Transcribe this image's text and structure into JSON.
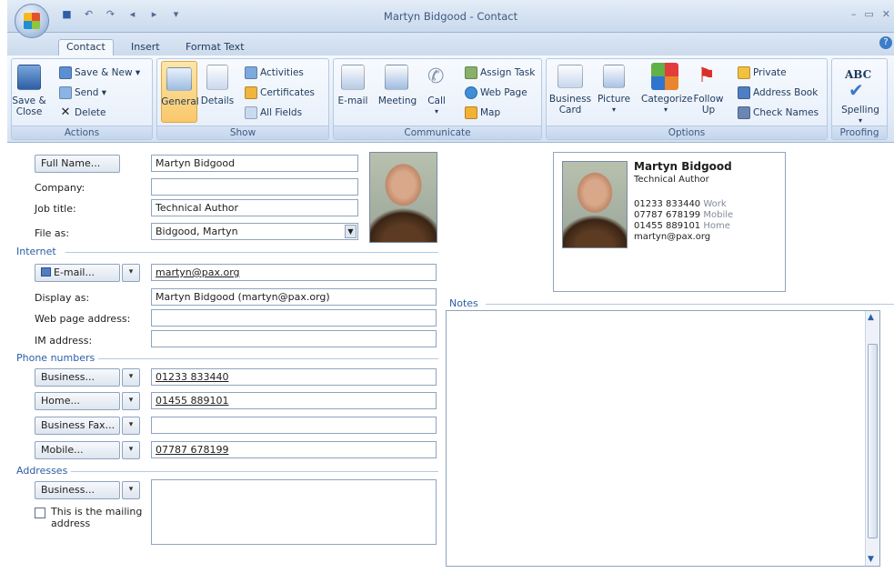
{
  "window": {
    "title": "Martyn Bidgood - Contact",
    "controls": [
      "–",
      "▭",
      "✕"
    ]
  },
  "qat": [
    "save-icon",
    "undo-icon",
    "redo-icon",
    "previous-icon",
    "next-icon",
    "customize-icon"
  ],
  "tabs": [
    {
      "label": "Contact",
      "active": true
    },
    {
      "label": "Insert",
      "active": false
    },
    {
      "label": "Format Text",
      "active": false
    }
  ],
  "ribbon": {
    "actions": {
      "label": "Actions",
      "save_close": "Save &\nClose",
      "save_new": "Save & New",
      "send": "Send",
      "delete": "Delete"
    },
    "show": {
      "label": "Show",
      "general": "General",
      "details": "Details",
      "activities": "Activities",
      "certificates": "Certificates",
      "all_fields": "All Fields"
    },
    "communicate": {
      "label": "Communicate",
      "email": "E-mail",
      "meeting": "Meeting",
      "call": "Call",
      "assign_task": "Assign Task",
      "web_page": "Web Page",
      "map": "Map"
    },
    "options": {
      "label": "Options",
      "business_card": "Business\nCard",
      "picture": "Picture",
      "categorize": "Categorize",
      "follow_up": "Follow\nUp",
      "private": "Private",
      "address_book": "Address Book",
      "check_names": "Check Names"
    },
    "proofing": {
      "label": "Proofing",
      "abc": "ABC",
      "spelling": "Spelling"
    }
  },
  "form": {
    "full_name_btn": "Full Name...",
    "full_name": "Martyn Bidgood",
    "company_label": "Company:",
    "company": "",
    "job_title_label": "Job title:",
    "job_title": "Technical Author",
    "file_as_label": "File as:",
    "file_as": "Bidgood, Martyn",
    "internet_header": "Internet",
    "email_btn": "E-mail...",
    "email": "martyn@pax.org",
    "display_as_label": "Display as:",
    "display_as": "Martyn Bidgood (martyn@pax.org)",
    "web_label": "Web page address:",
    "web": "",
    "im_label": "IM address:",
    "im": "",
    "phone_header": "Phone numbers",
    "phones": [
      {
        "btn": "Business...",
        "value": "01233 833440"
      },
      {
        "btn": "Home...",
        "value": "01455 889101"
      },
      {
        "btn": "Business Fax...",
        "value": ""
      },
      {
        "btn": "Mobile...",
        "value": "07787 678199"
      }
    ],
    "addresses_header": "Addresses",
    "address_btn": "Business...",
    "address": "",
    "mailing_checkbox": "This is the mailing\naddress",
    "mailing_checked": false
  },
  "business_card": {
    "name": "Martyn Bidgood",
    "title": "Technical Author",
    "lines": [
      {
        "value": "01233 833440",
        "tag": "Work"
      },
      {
        "value": "07787 678199",
        "tag": "Mobile"
      },
      {
        "value": "01455 889101",
        "tag": "Home"
      },
      {
        "value": "martyn@pax.org",
        "tag": ""
      }
    ]
  },
  "notes": {
    "label": "Notes",
    "text": ""
  }
}
